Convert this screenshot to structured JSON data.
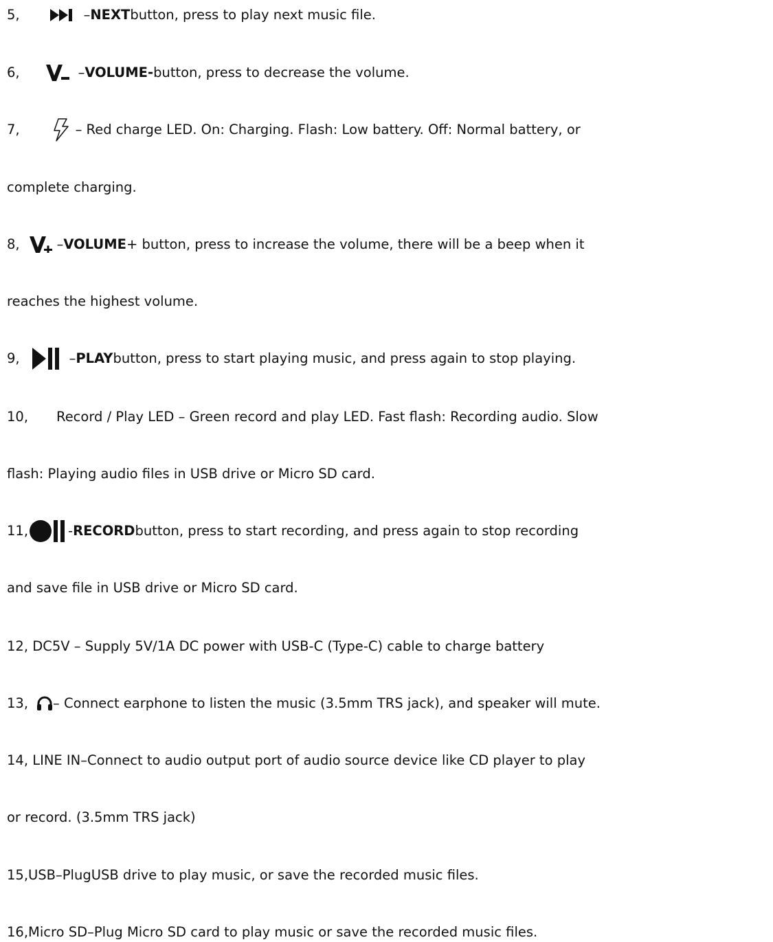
{
  "items": [
    {
      "num": "5,",
      "bold": "NEXT",
      "lead": "–",
      "text": " button, press to play next music file."
    },
    {
      "num": "6,",
      "bold": "VOLUME-",
      "lead": "–",
      "text": " button, press to decrease the volume."
    },
    {
      "num": "7,",
      "text": "– Red charge LED. On: Charging. Flash: Low battery. Off: Normal battery, or",
      "cont": "complete charging."
    },
    {
      "num": "8,",
      "bold": "VOLUME",
      "lead": "–",
      "text": "+ button, press to increase the volume, there will be a beep when it",
      "cont": "reaches the highest volume."
    },
    {
      "num": "9,",
      "bold": "PLAY",
      "lead": "–",
      "text": " button, press to start playing music, and press again to stop playing."
    },
    {
      "num": "10,",
      "text": "Record / Play LED – Green record and play LED. Fast flash: Recording audio. Slow",
      "cont": "flash: Playing audio files in USB drive or Micro SD card."
    },
    {
      "num": "11,",
      "bold": "RECORD",
      "lead": "-",
      "text": " button, press to start recording, and press again to stop recording",
      "cont": "and save file in USB drive or Micro SD card."
    },
    {
      "text": "12, DC5V – Supply 5V/1A DC power with USB-C (Type-C) cable to charge battery"
    },
    {
      "num": "13,",
      "text": "– Connect earphone to listen the music (3.5mm TRS jack), and speaker will mute."
    },
    {
      "text": "14, LINE IN–Connect to audio output port of audio source device like CD player to play",
      "cont": "or record. (3.5mm TRS jack)"
    },
    {
      "text": "15,USB–PlugUSB drive to play music, or save the recorded music files."
    },
    {
      "text": "16,Micro SD–Plug Micro SD card to play music or save the recorded music files."
    }
  ],
  "icons": {
    "next": "next-track-icon",
    "volume_down": "volume-down-icon",
    "charge": "charge-bolt-icon",
    "volume_up": "volume-up-icon",
    "play": "play-pause-icon",
    "record": "record-pause-icon",
    "headphone": "headphone-icon"
  }
}
